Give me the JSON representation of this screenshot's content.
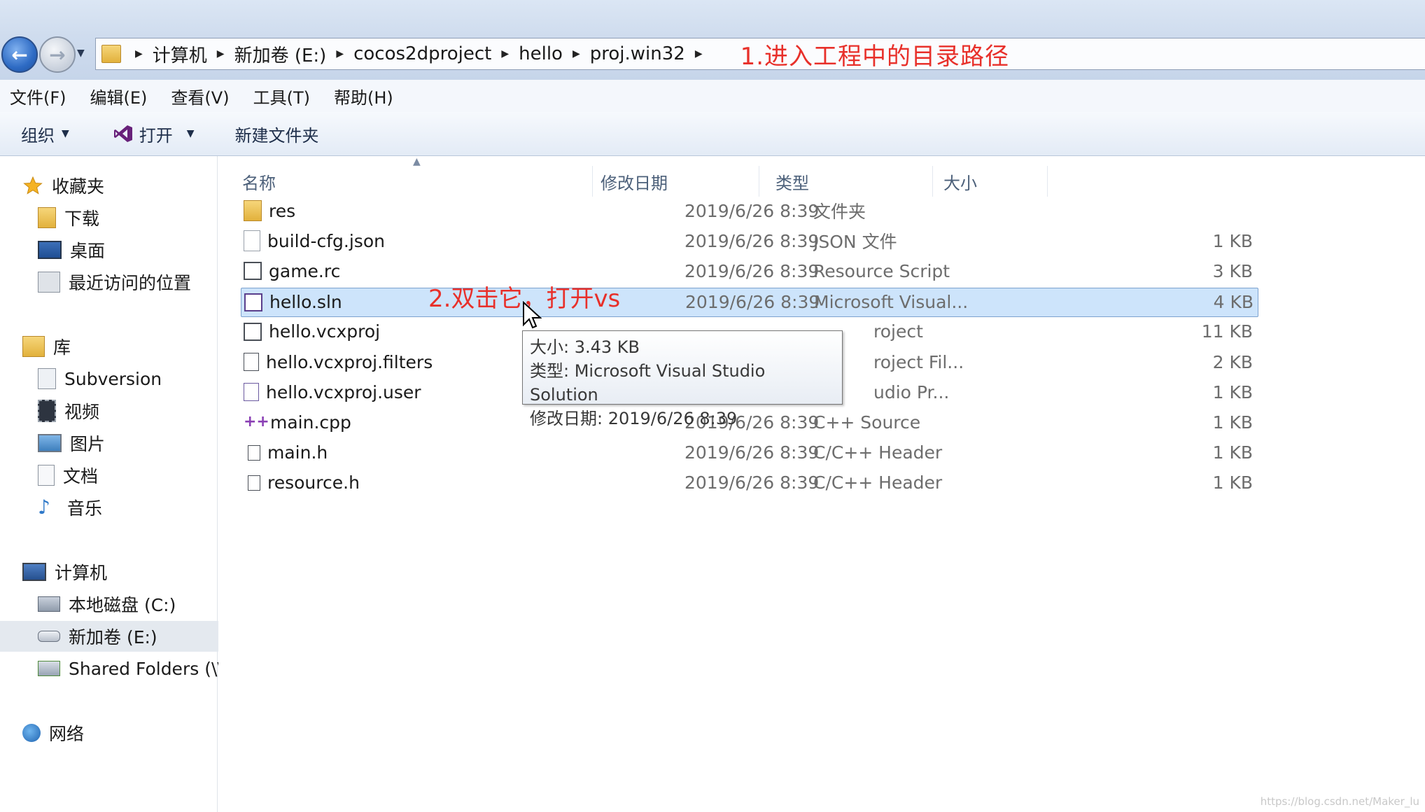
{
  "address_bar": {
    "crumbs": [
      "计算机",
      "新加卷 (E:)",
      "cocos2dproject",
      "hello",
      "proj.win32"
    ],
    "annotation": "1.进入工程中的目录路径"
  },
  "menubar": {
    "items": [
      "文件(F)",
      "编辑(E)",
      "查看(V)",
      "工具(T)",
      "帮助(H)"
    ]
  },
  "toolbar": {
    "organize": "组织",
    "open": "打开",
    "new_folder": "新建文件夹"
  },
  "nav": {
    "favorites": "收藏夹",
    "downloads": "下载",
    "desktop": "桌面",
    "recent": "最近访问的位置",
    "libraries": "库",
    "subversion": "Subversion",
    "videos": "视频",
    "pictures": "图片",
    "documents": "文档",
    "music": "音乐",
    "computer": "计算机",
    "local_disk": "本地磁盘 (C:)",
    "new_volume": "新加卷 (E:)",
    "shared": "Shared Folders (\\\\",
    "network": "网络"
  },
  "columns": {
    "name": "名称",
    "date": "修改日期",
    "type": "类型",
    "size": "大小"
  },
  "files": [
    {
      "name": "res",
      "date": "2019/6/26 8:39",
      "type": "文件夹",
      "size": "",
      "icon": "folder-icon"
    },
    {
      "name": "build-cfg.json",
      "date": "2019/6/26 8:39",
      "type": "JSON 文件",
      "size": "1 KB",
      "icon": "file-icon"
    },
    {
      "name": "game.rc",
      "date": "2019/6/26 8:39",
      "type": "Resource Script",
      "size": "3 KB",
      "icon": "resource-icon"
    },
    {
      "name": "hello.sln",
      "date": "2019/6/26 8:39",
      "type": "Microsoft Visual...",
      "size": "4 KB",
      "icon": "vs-solution-icon"
    },
    {
      "name": "hello.vcxproj",
      "date": "",
      "type": "roject",
      "size": "11 KB",
      "icon": "vcxproj-icon"
    },
    {
      "name": "hello.vcxproj.filters",
      "date": "",
      "type": "roject Fil...",
      "size": "2 KB",
      "icon": "filters-icon"
    },
    {
      "name": "hello.vcxproj.user",
      "date": "",
      "type": "udio Pr...",
      "size": "1 KB",
      "icon": "user-file-icon"
    },
    {
      "name": "main.cpp",
      "date": "2019/6/26 8:39",
      "type": "C++ Source",
      "size": "1 KB",
      "icon": "cpp-icon"
    },
    {
      "name": "main.h",
      "date": "2019/6/26 8:39",
      "type": "C/C++ Header",
      "size": "1 KB",
      "icon": "header-icon"
    },
    {
      "name": "resource.h",
      "date": "2019/6/26 8:39",
      "type": "C/C++ Header",
      "size": "1 KB",
      "icon": "header-icon"
    }
  ],
  "annotation_open": "2.双击它，打开vs",
  "tooltip": {
    "size": "大小: 3.43 KB",
    "type": "类型: Microsoft Visual Studio Solution",
    "date": "修改日期: 2019/6/26 8:39"
  },
  "watermark": "https://blog.csdn.net/Maker_lu"
}
